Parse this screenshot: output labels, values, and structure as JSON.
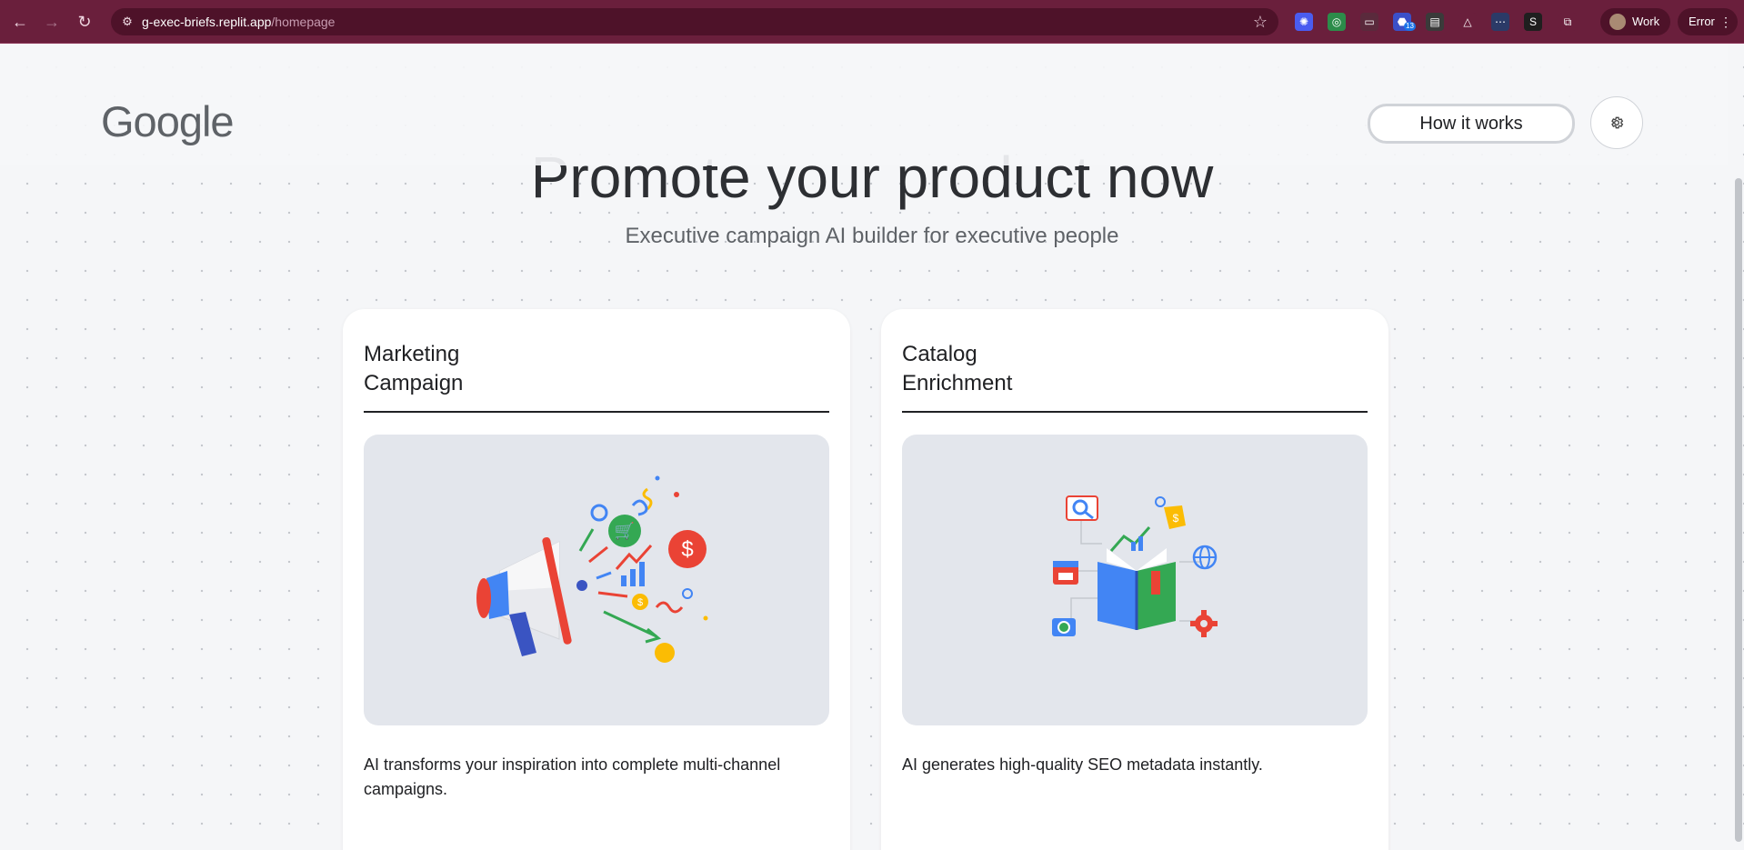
{
  "browser": {
    "url_host": "g-exec-briefs.replit.app",
    "url_path": "/homepage",
    "extensions": [
      {
        "name": "extension-1-icon",
        "color": "#4a5cf0",
        "glyph": "✺"
      },
      {
        "name": "extension-2-icon",
        "color": "#2c8c4a",
        "glyph": "◎"
      },
      {
        "name": "extension-3-icon",
        "color": "#5a2a3c",
        "glyph": "▭"
      },
      {
        "name": "extension-4-icon",
        "color": "#3a50c8",
        "glyph": "⬣",
        "badge": "13"
      },
      {
        "name": "extension-5-icon",
        "color": "#3a3a3a",
        "glyph": "▤"
      },
      {
        "name": "extension-6-icon",
        "color": "#6a1f3c",
        "glyph": "△"
      },
      {
        "name": "extension-7-icon",
        "color": "#2b3a67",
        "glyph": "⋯"
      },
      {
        "name": "extension-8-icon",
        "color": "#1f1f1f",
        "glyph": "S"
      },
      {
        "name": "extensions-puzzle-icon",
        "color": "#6a1f3c",
        "glyph": "⧉"
      }
    ],
    "profile_label": "Work",
    "error_label": "Error"
  },
  "header": {
    "logo_text": "Google",
    "how_it_works_label": "How it works"
  },
  "hero": {
    "title": "Promote your product now",
    "subtitle": "Executive campaign AI builder for executive people"
  },
  "cards": [
    {
      "title": "Marketing\nCampaign",
      "description": "AI transforms your inspiration into complete multi-channel campaigns."
    },
    {
      "title": "Catalog\nEnrichment",
      "description": "AI generates high-quality SEO metadata instantly."
    }
  ],
  "colors": {
    "chrome": "#6a1f3c",
    "google_blue": "#4285f4",
    "google_red": "#ea4335",
    "google_green": "#34a853",
    "google_yellow": "#fbbc04"
  }
}
